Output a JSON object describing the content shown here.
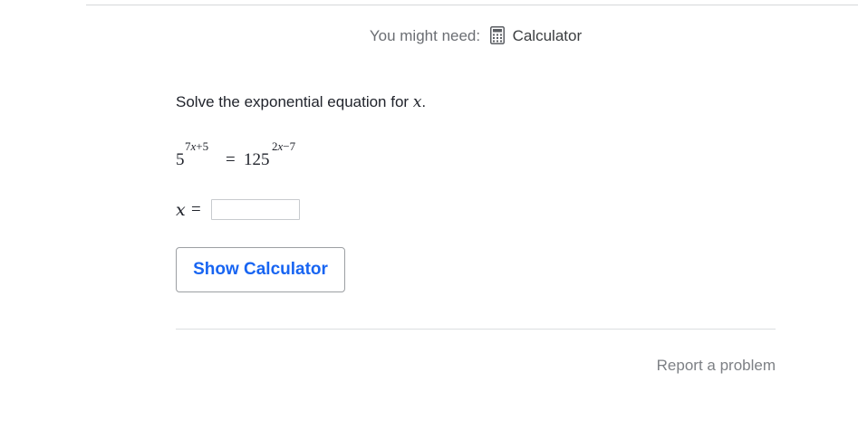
{
  "tools": {
    "need_label": "You might need:",
    "calculator_label": "Calculator",
    "calculator_icon": "calculator-icon"
  },
  "question": {
    "prefix": "Solve the exponential equation for ",
    "variable": "x",
    "suffix": "."
  },
  "equation": {
    "left_base": "5",
    "left_exponent": "7x+5",
    "equals": "=",
    "right_base": "125",
    "right_exponent": "2x−7"
  },
  "answer": {
    "variable": "x",
    "equals": "=",
    "value": "",
    "placeholder": ""
  },
  "buttons": {
    "show_calculator": "Show Calculator"
  },
  "footer": {
    "report_label": "Report a problem"
  },
  "colors": {
    "accent": "#1865f2",
    "text": "#21242c",
    "muted": "#7d8085",
    "rule": "#dcdee0"
  }
}
